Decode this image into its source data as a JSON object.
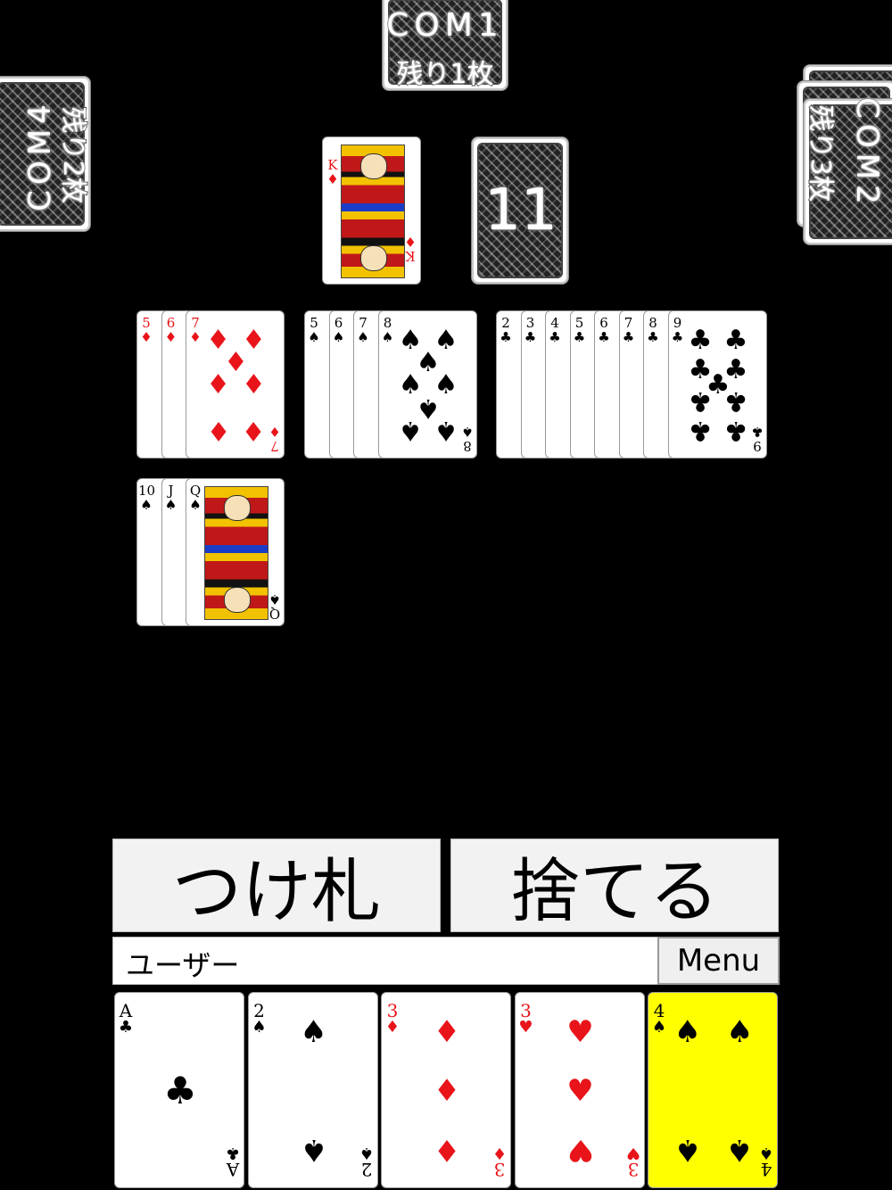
{
  "opponents": {
    "com1": {
      "name": "COM1",
      "remaining": "残り1枚"
    },
    "com2": {
      "name": "COM2",
      "remaining": "残り3枚"
    },
    "com4": {
      "name": "COM4",
      "remaining": "残り2枚"
    }
  },
  "discard_top": {
    "rank": "K",
    "suit": "♦"
  },
  "deck_count": "11",
  "table_rows": [
    {
      "suit": "♦",
      "ranks": [
        "5",
        "6",
        "7"
      ]
    },
    {
      "suit": "♠",
      "ranks": [
        "5",
        "6",
        "7",
        "8"
      ]
    },
    {
      "suit": "♣",
      "ranks": [
        "2",
        "3",
        "4",
        "5",
        "6",
        "7",
        "8",
        "9"
      ]
    },
    {
      "suit": "♠",
      "ranks": [
        "10",
        "J",
        "Q"
      ]
    }
  ],
  "actions": {
    "attach_label": "つけ札",
    "discard_label": "捨てる"
  },
  "player": {
    "name": "ユーザー",
    "menu_label": "Menu"
  },
  "hand": [
    {
      "rank": "A",
      "suit": "♣",
      "selected": false
    },
    {
      "rank": "2",
      "suit": "♠",
      "selected": false
    },
    {
      "rank": "3",
      "suit": "♦",
      "selected": false
    },
    {
      "rank": "3",
      "suit": "♥",
      "selected": false
    },
    {
      "rank": "4",
      "suit": "♠",
      "selected": true
    }
  ],
  "colors": {
    "table": "#000000",
    "selected_card": "#ffff00",
    "red_suit": "#e8141a",
    "button_bg": "#f2f2f2"
  }
}
